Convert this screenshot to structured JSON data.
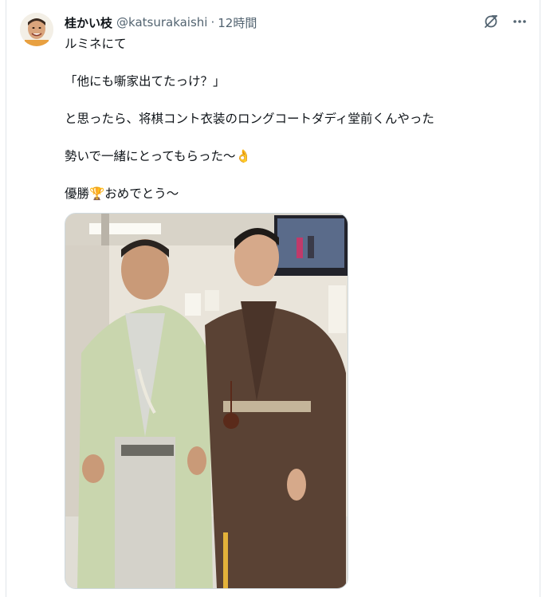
{
  "tweet": {
    "display_name": "桂かい枝",
    "handle": "@katsurakaishi",
    "separator": "·",
    "time": "12時間",
    "lines": [
      "ルミネにて",
      "「他にも噺家出てたっけ？」",
      "と思ったら、将棋コント衣装のロングコートダディ堂前くんやった",
      "勢いで一緒にとってもらった〜👌",
      "優勝🏆おめでとう〜"
    ]
  },
  "icons": {
    "grok": "grok-icon",
    "more": "more-icon"
  },
  "colors": {
    "text": "#0f1419",
    "secondary": "#536471",
    "border": "#e1e6ea"
  }
}
